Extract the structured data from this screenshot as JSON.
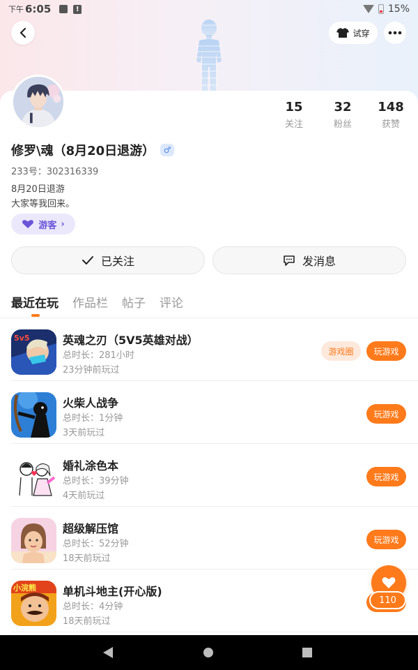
{
  "status_bar": {
    "ampm": "下午",
    "time": "6:05",
    "battery": "15%"
  },
  "header": {
    "try_on_label": "试穿"
  },
  "profile": {
    "username": "修罗\\魂（8月20日退游）",
    "gender_symbol": "♂",
    "uid": "233号：302316339",
    "bio_line1": "8月20日退游",
    "bio_line2": "大家等我回来。",
    "badge_label": "游客",
    "badge_chevron": "›",
    "stats": [
      {
        "value": "15",
        "label": "关注"
      },
      {
        "value": "32",
        "label": "粉丝"
      },
      {
        "value": "148",
        "label": "获赞"
      }
    ]
  },
  "actions": {
    "follow_label": "已关注",
    "message_label": "发消息"
  },
  "tabs": [
    {
      "label": "最近在玩",
      "active": true
    },
    {
      "label": "作品栏",
      "active": false
    },
    {
      "label": "帖子",
      "active": false
    },
    {
      "label": "评论",
      "active": false
    }
  ],
  "games": [
    {
      "name": "英魂之刃（5V5英雄对战）",
      "duration": "总时长：281小时",
      "last_played": "23分钟前玩过",
      "circle_label": "游戏圈",
      "play_label": "玩游戏",
      "icon": "hero-blade-icon"
    },
    {
      "name": "火柴人战争",
      "duration": "总时长：1分钟",
      "last_played": "3天前玩过",
      "play_label": "玩游戏",
      "icon": "stickman-war-icon"
    },
    {
      "name": "婚礼涂色本",
      "duration": "总时长：39分钟",
      "last_played": "4天前玩过",
      "play_label": "玩游戏",
      "icon": "wedding-coloring-icon"
    },
    {
      "name": "超级解压馆",
      "duration": "总时长：52分钟",
      "last_played": "18天前玩过",
      "play_label": "玩游戏",
      "icon": "stress-relief-icon"
    },
    {
      "name": "单机斗地主(开心版)",
      "duration": "总时长：4分钟",
      "last_played": "18天前玩过",
      "play_label": "玩游戏",
      "icon": "landlord-card-icon"
    }
  ],
  "like_fab": {
    "count": "110"
  },
  "colors": {
    "accent": "#ff7a1a",
    "badge_purple": "#6a55d8"
  }
}
